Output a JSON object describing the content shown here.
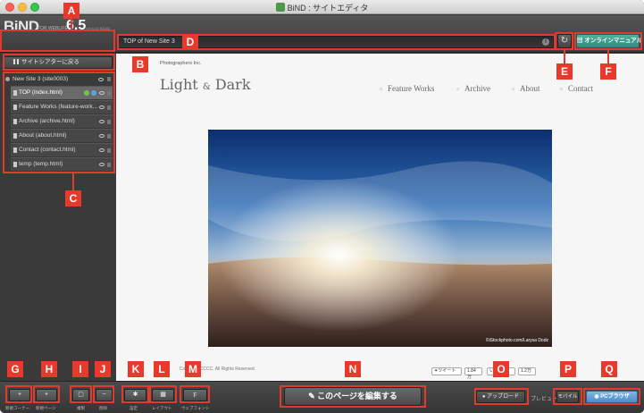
{
  "window": {
    "title": "BiND : サイトエディタ"
  },
  "toolbar": {
    "logo": "BiND",
    "logo_sub": "FOR WEBLIFE*",
    "version": "6.5",
    "version_sub": "Ver.6.50 B1183",
    "url": "TOP of New Site 3",
    "info_icon": "i",
    "refresh_icon": "↻",
    "manual_label": "オンラインマニュアル"
  },
  "sidebar": {
    "back_label": "サイトシアターに戻る",
    "site_name": "New Site 3 (site0003)",
    "pages": [
      {
        "label": "TOP (index.html)",
        "selected": true
      },
      {
        "label": "Feature Works (feature-work...",
        "selected": false
      },
      {
        "label": "Archive (archive.html)",
        "selected": false
      },
      {
        "label": "About (about.html)",
        "selected": false
      },
      {
        "label": "Contact (contact.html)",
        "selected": false
      },
      {
        "label": "temp (temp.html)",
        "selected": false
      }
    ]
  },
  "preview": {
    "company": "Photographers Inc.",
    "logo_main": "Light",
    "logo_amp": "&",
    "logo_end": "Dark",
    "nav": [
      "Feature Works",
      "Archive",
      "About",
      "Contact"
    ],
    "hero_credit": "©iStockphoto.com/Larysa Dodz",
    "copyright": "Copyright CCCC. All Rights Reserved.",
    "tweet": "ツイート",
    "tweet_count": "1.84万",
    "like": "いいね！",
    "like_count": "1.2万"
  },
  "bottom": {
    "new_corner": {
      "icon": "+",
      "caption": "新規コーナー"
    },
    "new_page": {
      "icon": "+",
      "caption": "新規ページ"
    },
    "duplicate": {
      "icon": "▢",
      "caption": "複製"
    },
    "delete": {
      "icon": "−",
      "caption": "削除"
    },
    "settings": {
      "icon": "✱",
      "caption": "設定"
    },
    "layout": {
      "icon": "▦",
      "caption": "レイアウト"
    },
    "webfont": {
      "icon": "F",
      "caption": "ウェブフォント"
    },
    "edit_label": "このページを編集する",
    "upload_label": "アップロード",
    "preview_label": "プレビュー",
    "mobile_label": "モバイル",
    "pc_label": "PCブラウザ"
  },
  "annotations": [
    "A",
    "B",
    "C",
    "D",
    "E",
    "F",
    "G",
    "H",
    "I",
    "J",
    "K",
    "L",
    "M",
    "N",
    "O",
    "P",
    "Q"
  ],
  "colors": {
    "annotation": "#e8392c",
    "manual": "#2e8a7c",
    "pc_browser": "#4b8cc6"
  }
}
